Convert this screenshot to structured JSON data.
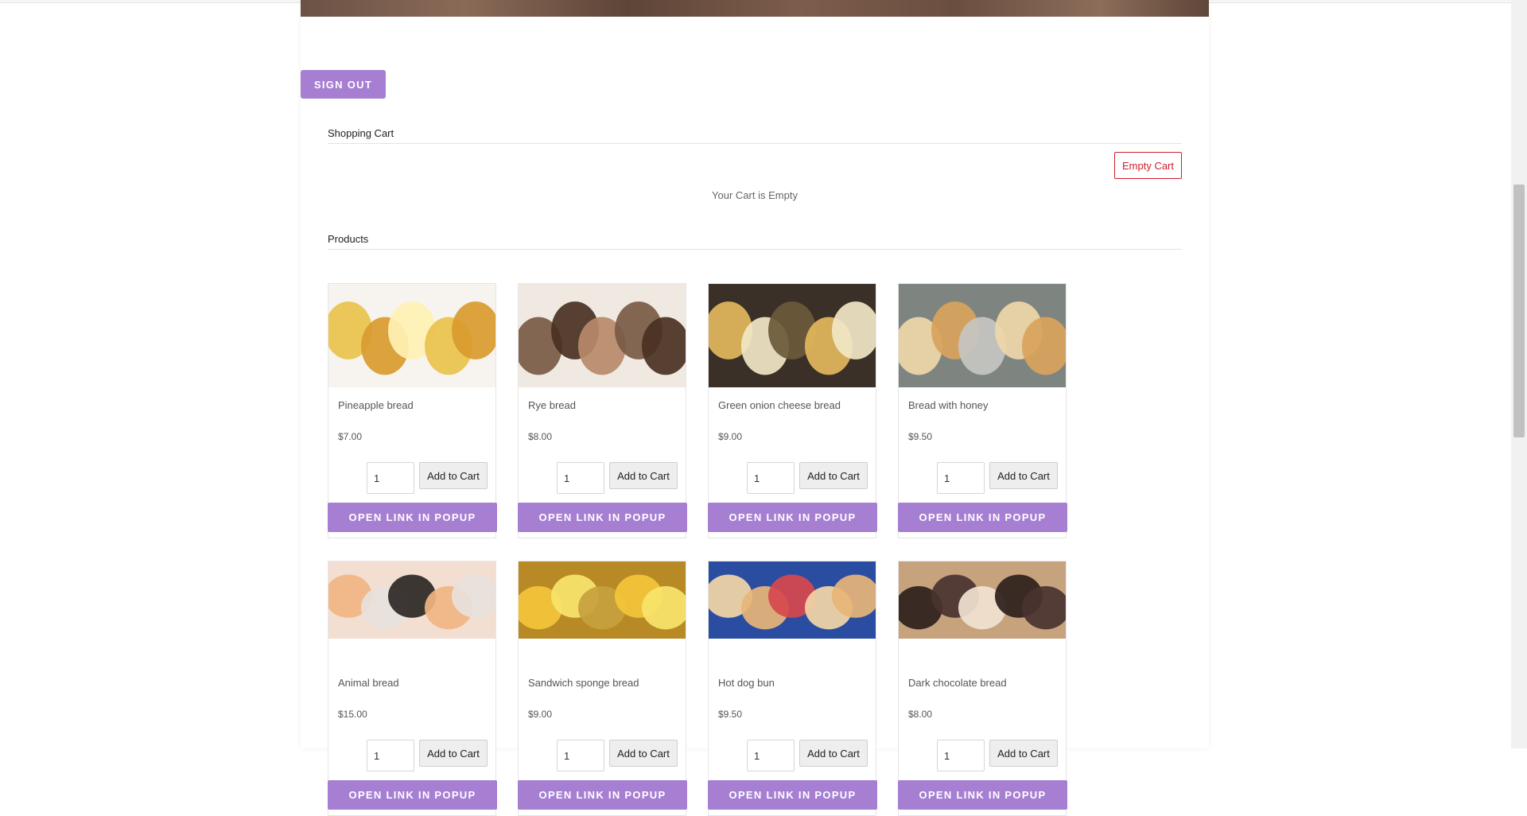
{
  "header": {
    "signout_label": "SIGN OUT"
  },
  "cart": {
    "title": "Shopping Cart",
    "empty_button_label": "Empty Cart",
    "empty_message": "Your Cart is Empty"
  },
  "products_section": {
    "title": "Products"
  },
  "products": [
    {
      "name": "Pineapple bread",
      "price": "$7.00",
      "qty": "1",
      "add_label": "Add to Cart",
      "popup_label": "OPEN LINK IN POPUP",
      "img_colors": [
        "#f7f4ef",
        "#e9c24d",
        "#d89a2e",
        "#fff1b4"
      ]
    },
    {
      "name": "Rye bread",
      "price": "$8.00",
      "qty": "1",
      "add_label": "Add to Cart",
      "popup_label": "OPEN LINK IN POPUP",
      "img_colors": [
        "#efe9e2",
        "#7a5a45",
        "#4a3022",
        "#b7896a"
      ]
    },
    {
      "name": "Green onion cheese bread",
      "price": "$9.00",
      "qty": "1",
      "add_label": "Add to Cart",
      "popup_label": "OPEN LINK IN POPUP",
      "img_colors": [
        "#3a3027",
        "#e3b75b",
        "#f1e7c6",
        "#6b5a3a"
      ]
    },
    {
      "name": "Bread with honey",
      "price": "$9.50",
      "qty": "1",
      "add_label": "Add to Cart",
      "popup_label": "OPEN LINK IN POPUP",
      "img_colors": [
        "#7e8580",
        "#efd7a9",
        "#d9a35c",
        "#c6c6c2"
      ]
    },
    {
      "name": "Animal bread",
      "price": "$15.00",
      "qty": "1",
      "add_label": "Add to Cart",
      "popup_label": "OPEN LINK IN POPUP",
      "img_colors": [
        "#f2dfd2",
        "#f1b582",
        "#e8e1dc",
        "#2d2725"
      ]
    },
    {
      "name": "Sandwich sponge bread",
      "price": "$9.00",
      "qty": "1",
      "add_label": "Add to Cart",
      "popup_label": "OPEN LINK IN POPUP",
      "img_colors": [
        "#b88a26",
        "#f4c63a",
        "#f7e46b",
        "#c6a13d"
      ]
    },
    {
      "name": "Hot dog bun",
      "price": "$9.50",
      "qty": "1",
      "add_label": "Add to Cart",
      "popup_label": "OPEN LINK IN POPUP",
      "img_colors": [
        "#2a4da2",
        "#f3d6a6",
        "#e7b577",
        "#d7484d"
      ]
    },
    {
      "name": "Dark chocolate bread",
      "price": "$8.00",
      "qty": "1",
      "add_label": "Add to Cart",
      "popup_label": "OPEN LINK IN POPUP",
      "img_colors": [
        "#c6a27d",
        "#2c1f1c",
        "#4a3330",
        "#f0e2d0"
      ]
    }
  ],
  "colors": {
    "accent": "#a67fd3",
    "danger": "#cc1f2d"
  }
}
